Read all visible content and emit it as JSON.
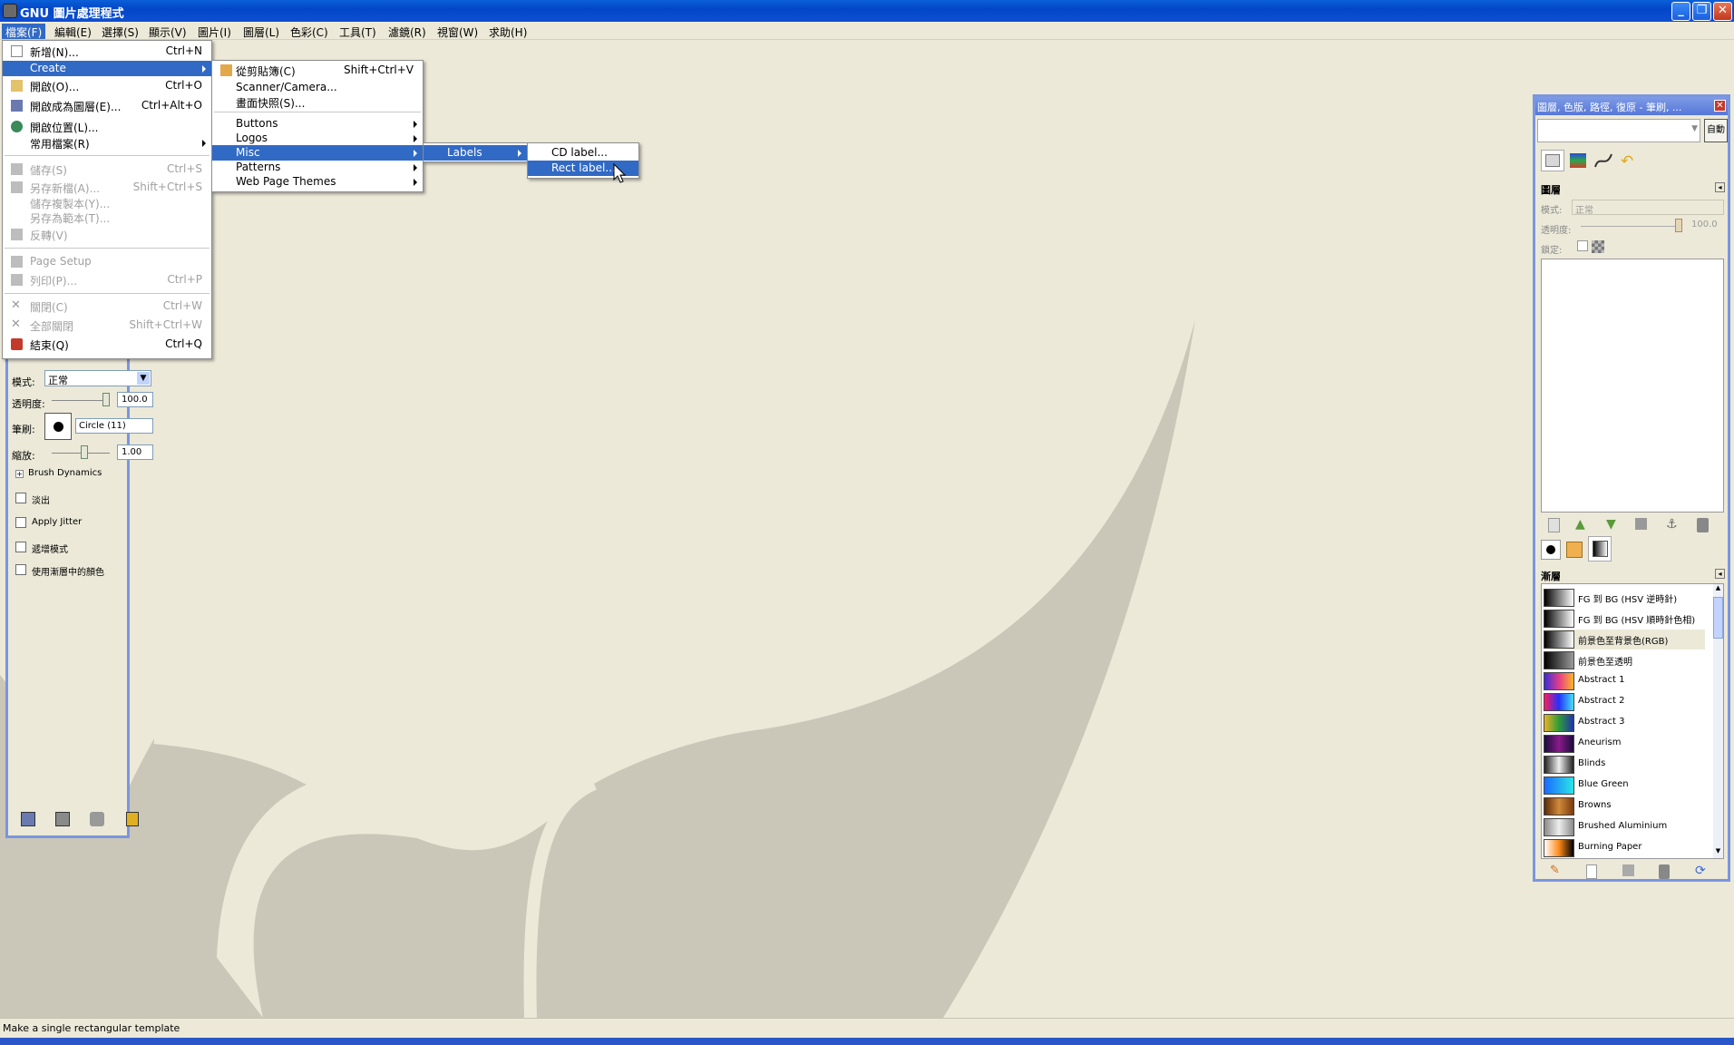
{
  "window": {
    "title": "GNU 圖片處理程式"
  },
  "menubar": {
    "items": [
      "檔案(F)",
      "編輯(E)",
      "選擇(S)",
      "顯示(V)",
      "圖片(I)",
      "圖層(L)",
      "色彩(C)",
      "工具(T)",
      "濾鏡(R)",
      "視窗(W)",
      "求助(H)"
    ]
  },
  "file_menu": {
    "items": [
      {
        "label": "新增(N)...",
        "shortcut": "Ctrl+N"
      },
      {
        "label": "Create",
        "shortcut": ""
      },
      {
        "label": "開啟(O)...",
        "shortcut": "Ctrl+O"
      },
      {
        "label": "開啟成為圖層(E)...",
        "shortcut": "Ctrl+Alt+O"
      },
      {
        "label": "開啟位置(L)...",
        "shortcut": ""
      },
      {
        "label": "常用檔案(R)",
        "shortcut": ""
      },
      {
        "label": "儲存(S)",
        "shortcut": "Ctrl+S"
      },
      {
        "label": "另存新檔(A)...",
        "shortcut": "Shift+Ctrl+S"
      },
      {
        "label": "儲存複製本(Y)...",
        "shortcut": ""
      },
      {
        "label": "另存為範本(T)...",
        "shortcut": ""
      },
      {
        "label": "反轉(V)",
        "shortcut": ""
      },
      {
        "label": "Page Setup",
        "shortcut": ""
      },
      {
        "label": "列印(P)...",
        "shortcut": "Ctrl+P"
      },
      {
        "label": "關閉(C)",
        "shortcut": "Ctrl+W"
      },
      {
        "label": "全部關閉",
        "shortcut": "Shift+Ctrl+W"
      },
      {
        "label": "結束(Q)",
        "shortcut": "Ctrl+Q"
      }
    ]
  },
  "create_menu": {
    "items": [
      {
        "label": "從剪貼簿(C)",
        "shortcut": "Shift+Ctrl+V"
      },
      {
        "label": "Scanner/Camera...",
        "shortcut": ""
      },
      {
        "label": "畫面快照(S)...",
        "shortcut": ""
      },
      {
        "label": "Buttons",
        "shortcut": ""
      },
      {
        "label": "Logos",
        "shortcut": ""
      },
      {
        "label": "Misc",
        "shortcut": ""
      },
      {
        "label": "Patterns",
        "shortcut": ""
      },
      {
        "label": "Web Page Themes",
        "shortcut": ""
      }
    ]
  },
  "misc_menu": {
    "items": [
      {
        "label": "Labels"
      }
    ]
  },
  "labels_menu": {
    "items": [
      {
        "label": "CD label..."
      },
      {
        "label": "Rect label..."
      }
    ]
  },
  "toolbox": {
    "mode_label": "模式:",
    "mode_value": "正常",
    "opacity_label": "透明度:",
    "opacity_value": "100.0",
    "brush_label": "筆刷:",
    "brush_value": "Circle (11)",
    "scale_label": "縮放:",
    "scale_value": "1.00",
    "brush_dynamics": "Brush Dynamics",
    "options": [
      "淡出",
      "Apply Jitter",
      "遞增模式",
      "使用漸層中的顏色"
    ]
  },
  "dock": {
    "title": "圖層, 色版, 路徑, 復原 - 筆刷, ...",
    "auto_button": "自動",
    "layers_title": "圖層",
    "mode_label": "模式:",
    "mode_value": "正常",
    "opacity_label": "透明度:",
    "opacity_value": "100.0",
    "lock_label": "鎖定:",
    "gradients_title": "漸層",
    "gradients": [
      {
        "name": "FG 到 BG (HSV 逆時針)",
        "colors": [
          "#000000",
          "#ffffff"
        ]
      },
      {
        "name": "FG 到 BG (HSV 順時針色相)",
        "colors": [
          "#000000",
          "#ffffff"
        ]
      },
      {
        "name": "前景色至背景色(RGB)",
        "colors": [
          "#000000",
          "#ffffff"
        ]
      },
      {
        "name": "前景色至透明",
        "colors": [
          "#000000",
          "#9a9a9a"
        ]
      },
      {
        "name": "Abstract 1",
        "colors": [
          "#3a2dd6",
          "#e23c8a",
          "#ffb52a"
        ]
      },
      {
        "name": "Abstract 2",
        "colors": [
          "#ff1a5e",
          "#2233ff",
          "#44e0ff"
        ]
      },
      {
        "name": "Abstract 3",
        "colors": [
          "#e8b226",
          "#2d9c3a",
          "#2233aa"
        ]
      },
      {
        "name": "Aneurism",
        "colors": [
          "#1a0d3d",
          "#8a1a8a",
          "#1a0d3d"
        ]
      },
      {
        "name": "Blinds",
        "colors": [
          "#222222",
          "#eeeeee",
          "#222222"
        ]
      },
      {
        "name": "Blue Green",
        "colors": [
          "#1a6aff",
          "#2ae6e6"
        ]
      },
      {
        "name": "Browns",
        "colors": [
          "#5a2a0a",
          "#d08a3a",
          "#7a3a10"
        ]
      },
      {
        "name": "Brushed Aluminium",
        "colors": [
          "#8a8a8a",
          "#eeeeee",
          "#8a8a8a"
        ]
      },
      {
        "name": "Burning Paper",
        "colors": [
          "#ffffff",
          "#ff8a1a",
          "#000000"
        ]
      }
    ]
  },
  "status": {
    "text": "Make a single rectangular template"
  }
}
